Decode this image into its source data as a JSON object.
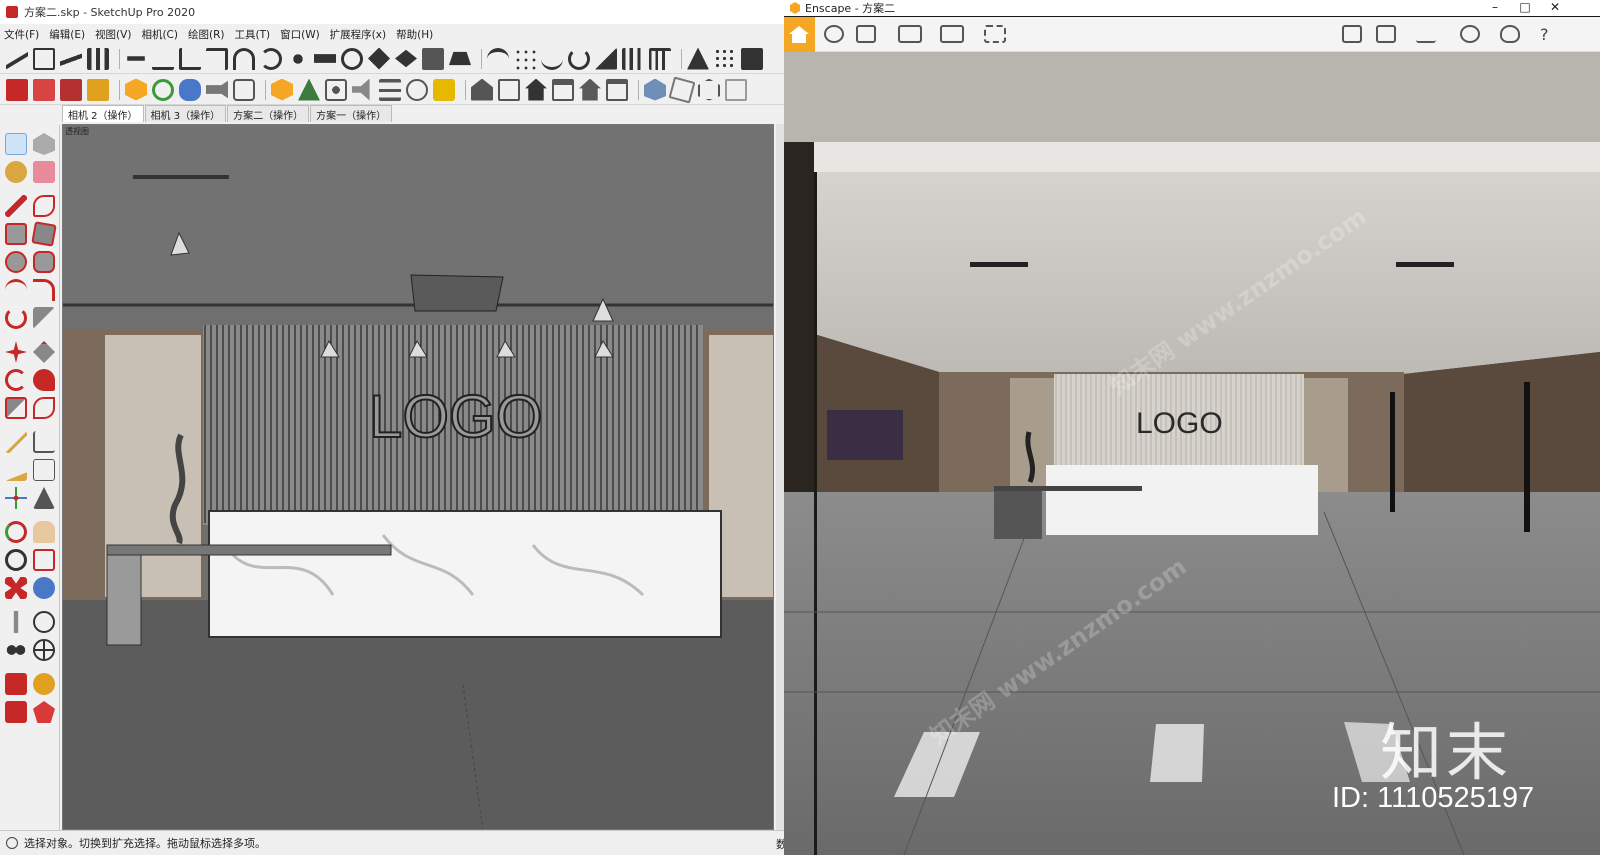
{
  "sketchup": {
    "title": "方案二.skp - SketchUp Pro 2020",
    "menu": [
      "文件(F)",
      "编辑(E)",
      "视图(V)",
      "相机(C)",
      "绘图(R)",
      "工具(T)",
      "窗口(W)",
      "扩展程序(x)",
      "帮助(H)"
    ],
    "tabs": [
      "相机 2（操作）",
      "相机 3（操作）",
      "方案二（操作）",
      "方案一（操作）"
    ],
    "viewport_label": "透视图",
    "scene_logo_text": "LOGO",
    "status_text": "选择对象。切换到扩充选择。拖动鼠标选择多项。",
    "measurement_label": "数值"
  },
  "enscape": {
    "title": "Enscape - 方案二",
    "scene_logo_text": "LOGO"
  },
  "watermark": {
    "text": "知末网 www.znzmo.com",
    "brand": "知末",
    "id_label": "ID: 1110525197"
  },
  "colors": {
    "enscape_accent": "#f5a623",
    "sketchup_accent": "#c62828"
  }
}
